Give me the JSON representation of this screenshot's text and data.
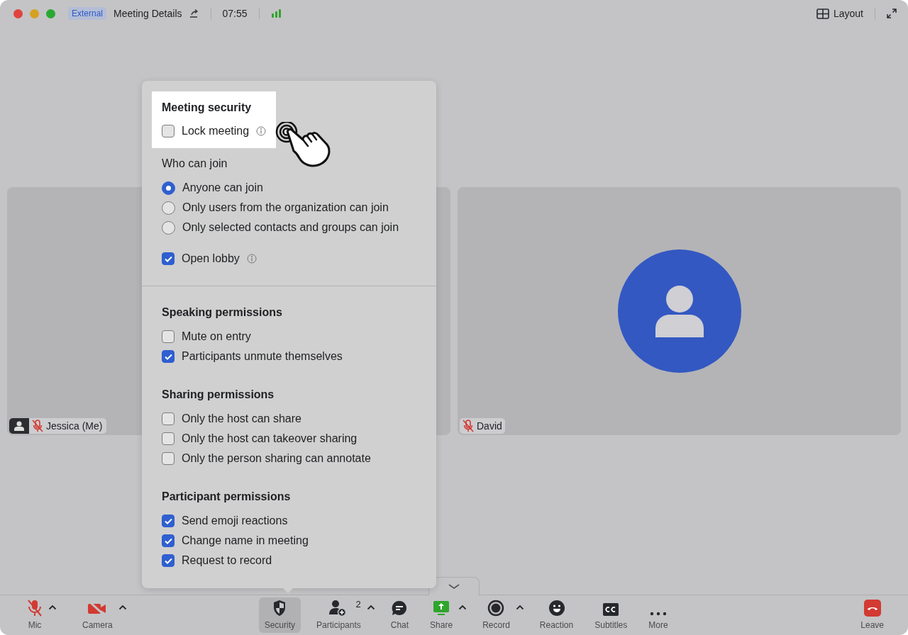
{
  "title_bar": {
    "badge": "External",
    "title": "Meeting Details",
    "time": "07:55",
    "layout_label": "Layout"
  },
  "tiles": [
    {
      "name": "Jessica",
      "suffix": "(Me)",
      "muted": true,
      "avatar": false
    },
    {
      "name": "David",
      "muted": true,
      "avatar": true
    }
  ],
  "security_panel": {
    "top_sections": [
      {
        "title": "Meeting security",
        "kind": "heading",
        "highlighted": true,
        "items": [
          {
            "kind": "checkbox",
            "label": "Lock meeting",
            "checked": false,
            "info": true
          }
        ]
      },
      {
        "title": "Who can join",
        "kind": "subheading",
        "highlighted": false,
        "items": [
          {
            "kind": "radio",
            "label": "Anyone can join",
            "selected": true
          },
          {
            "kind": "radio",
            "label": "Only users from the organization can join",
            "selected": false
          },
          {
            "kind": "radio",
            "label": "Only selected contacts and groups can join",
            "selected": false
          },
          {
            "kind": "checkbox",
            "label": "Open lobby",
            "checked": true,
            "info": true
          }
        ]
      }
    ],
    "bottom_sections": [
      {
        "title": "Speaking permissions",
        "kind": "heading",
        "highlighted": false,
        "items": [
          {
            "kind": "checkbox",
            "label": "Mute on entry",
            "checked": false
          },
          {
            "kind": "checkbox",
            "label": "Participants unmute themselves",
            "checked": true
          }
        ]
      },
      {
        "title": "Sharing permissions",
        "kind": "heading",
        "highlighted": false,
        "items": [
          {
            "kind": "checkbox",
            "label": "Only the host can share",
            "checked": false
          },
          {
            "kind": "checkbox",
            "label": "Only the host can takeover sharing",
            "checked": false
          },
          {
            "kind": "checkbox",
            "label": "Only the person sharing can annotate",
            "checked": false
          }
        ]
      },
      {
        "title": "Participant permissions",
        "kind": "heading",
        "highlighted": false,
        "items": [
          {
            "kind": "checkbox",
            "label": "Send emoji reactions",
            "checked": true
          },
          {
            "kind": "checkbox",
            "label": "Change name in meeting",
            "checked": true
          },
          {
            "kind": "checkbox",
            "label": "Request to record",
            "checked": true
          }
        ]
      }
    ]
  },
  "toolbar": {
    "left": [
      {
        "kind": "mic",
        "label": "Mic",
        "caret": true,
        "selected": false
      },
      {
        "kind": "camera",
        "label": "Camera",
        "caret": true,
        "selected": false
      }
    ],
    "center": [
      {
        "kind": "security",
        "label": "Security",
        "caret": false,
        "selected": true
      },
      {
        "kind": "participants",
        "label": "Participants",
        "caret": true,
        "selected": false,
        "badge": "2"
      },
      {
        "kind": "chat",
        "label": "Chat",
        "caret": false,
        "selected": false
      },
      {
        "kind": "share",
        "label": "Share",
        "caret": true,
        "selected": false
      },
      {
        "kind": "record",
        "label": "Record",
        "caret": true,
        "selected": false
      },
      {
        "kind": "reaction",
        "label": "Reaction",
        "caret": false,
        "selected": false
      },
      {
        "kind": "subtitles",
        "label": "Subtitles",
        "caret": false,
        "selected": false
      },
      {
        "kind": "more",
        "label": "More",
        "caret": false,
        "selected": false
      }
    ],
    "right": [
      {
        "kind": "leave",
        "label": "Leave",
        "caret": false,
        "selected": false
      }
    ]
  }
}
